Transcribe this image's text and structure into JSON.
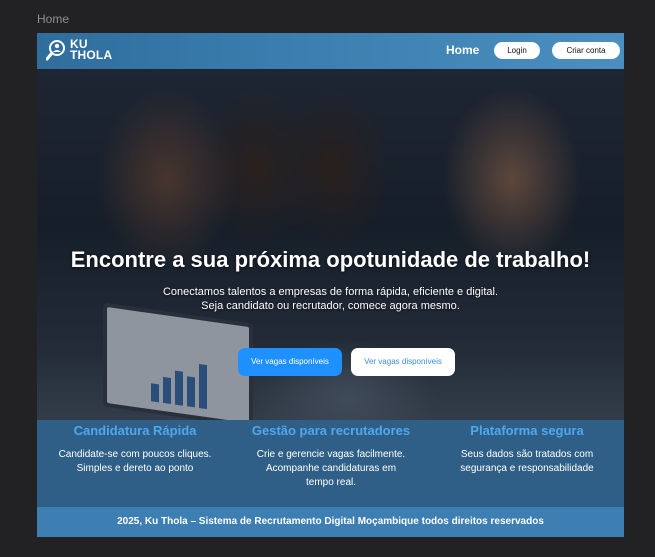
{
  "window": {
    "title": "Home"
  },
  "header": {
    "logo_text": "KU\nTHOLA",
    "nav_home": "Home",
    "login_label": "Login",
    "signup_label": "Criar conta"
  },
  "hero": {
    "title": "Encontre a sua próxima opotunidade de trabalho!",
    "subtitle_line1": "Conectamos talentos a empresas de forma rápida, eficiente e digital.",
    "subtitle_line2": "Seja candidato ou recrutador, comece agora mesmo.",
    "primary_cta": "Ver vagas disponíveis",
    "secondary_cta": "Ver vagas disponíveis"
  },
  "features": [
    {
      "title": "Candidatura Rápida",
      "lines": [
        "Candidate-se com poucos cliques.",
        "Simples e dereto ao ponto"
      ]
    },
    {
      "title": "Gestão para recrutadores",
      "lines": [
        "Crie e gerencie vagas facilmente.",
        "Acompanhe candidaturas em",
        "tempo real."
      ]
    },
    {
      "title": "Plataforma segura",
      "lines": [
        "Seus dados são tratados com",
        "segurança e responsabilidade"
      ]
    }
  ],
  "footer": {
    "text": "2025, Ku Thola – Sistema de Recrutamento Digital Moçambique todos direitos reservados"
  },
  "colors": {
    "header": "#3b7fb0",
    "primary_button": "#1e90ff",
    "feature_band": "#2f5f86",
    "feature_title": "#4fa8ee",
    "footer": "#3d7fb3"
  },
  "icons": {
    "logo": "search-person-icon"
  }
}
